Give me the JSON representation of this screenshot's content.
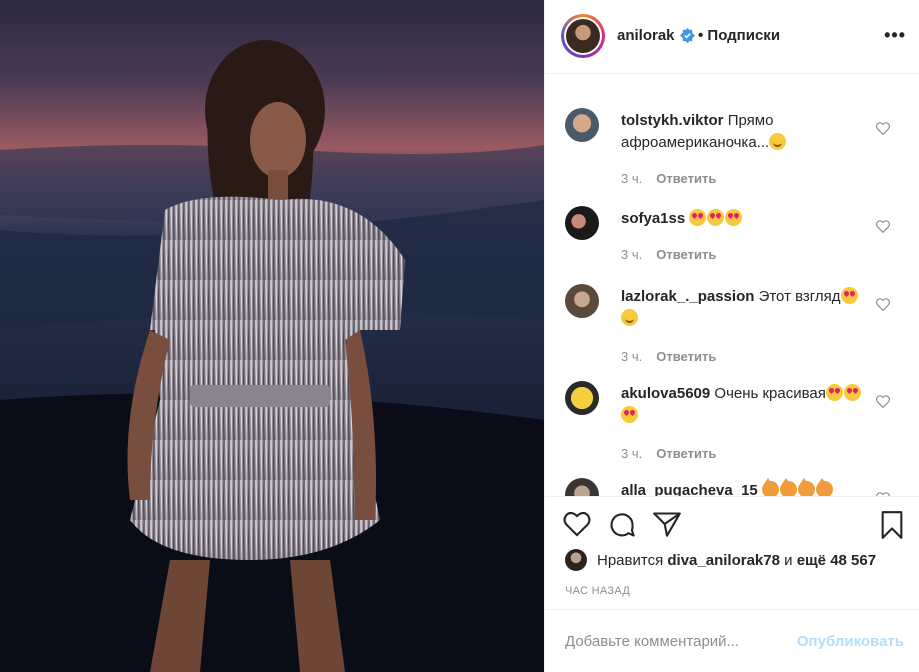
{
  "header": {
    "username": "anilorak",
    "follow_label": "• Подписки",
    "more_label": "•••"
  },
  "comments": [
    {
      "user": "tolstykh.viktor",
      "text": "Прямо афроамериканочка...",
      "emoji": [
        "smile"
      ],
      "time": "3 ч.",
      "reply": "Ответить"
    },
    {
      "user": "sofya1ss",
      "text": "",
      "emoji": [
        "love",
        "love",
        "love"
      ],
      "time": "3 ч.",
      "reply": "Ответить"
    },
    {
      "user": "lazlorak_._passion",
      "text": "Этот взгляд",
      "emoji": [
        "love",
        "smile"
      ],
      "time": "3 ч.",
      "reply": "Ответить"
    },
    {
      "user": "akulova5609",
      "text": "Очень красивая",
      "emoji": [
        "love",
        "love",
        "love"
      ],
      "time": "3 ч.",
      "reply": "Ответить"
    },
    {
      "user": "alla_pugacheva_15",
      "text": "",
      "emoji": [
        "cat",
        "cat",
        "cat",
        "cat"
      ],
      "time": "",
      "reply": ""
    }
  ],
  "likes": {
    "prefix": "Нравится",
    "user": "diva_anilorak78",
    "middle": "и",
    "count": "ещё 48 567"
  },
  "timestamp": "ЧАС НАЗАД",
  "add_comment": {
    "placeholder": "Добавьте комментарий...",
    "publish_label": "Опубликовать"
  },
  "colors": {
    "verified": "#3897f0",
    "muted": "#8e8e8e",
    "publish_disabled": "#b2dffc"
  }
}
